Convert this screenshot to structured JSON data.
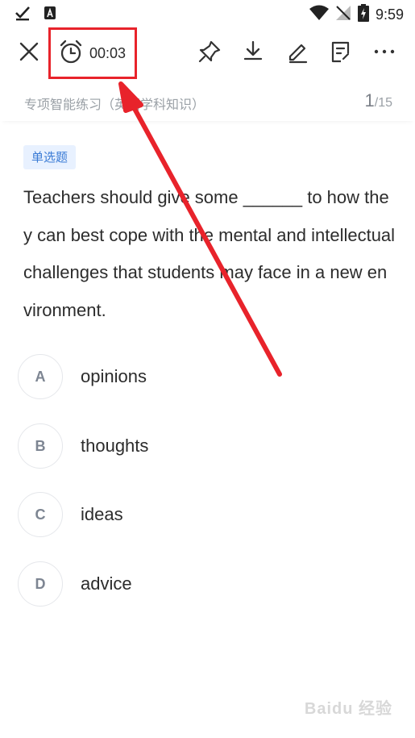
{
  "status_bar": {
    "time": "9:59"
  },
  "toolbar": {
    "timer": "00:03",
    "icons": [
      "close-icon",
      "alarm-clock-icon",
      "pin-icon",
      "download-icon",
      "edit-icon",
      "answer-sheet-icon",
      "more-icon"
    ]
  },
  "subheader": {
    "title": "专项智能练习（英语学科知识）",
    "current": "1",
    "separator": "/",
    "total": "15"
  },
  "question": {
    "type": "单选题",
    "text": "Teachers should give some ______ to how they can best cope with the mental and intellectual challenges that students may face in a new environment."
  },
  "options": [
    {
      "letter": "A",
      "text": "opinions"
    },
    {
      "letter": "B",
      "text": "thoughts"
    },
    {
      "letter": "C",
      "text": "ideas"
    },
    {
      "letter": "D",
      "text": "advice"
    }
  ],
  "watermark": "Baidu 经验",
  "colors": {
    "highlight": "#e8232b",
    "tag_bg": "#e8f1ff",
    "tag_text": "#3a7bd5"
  }
}
